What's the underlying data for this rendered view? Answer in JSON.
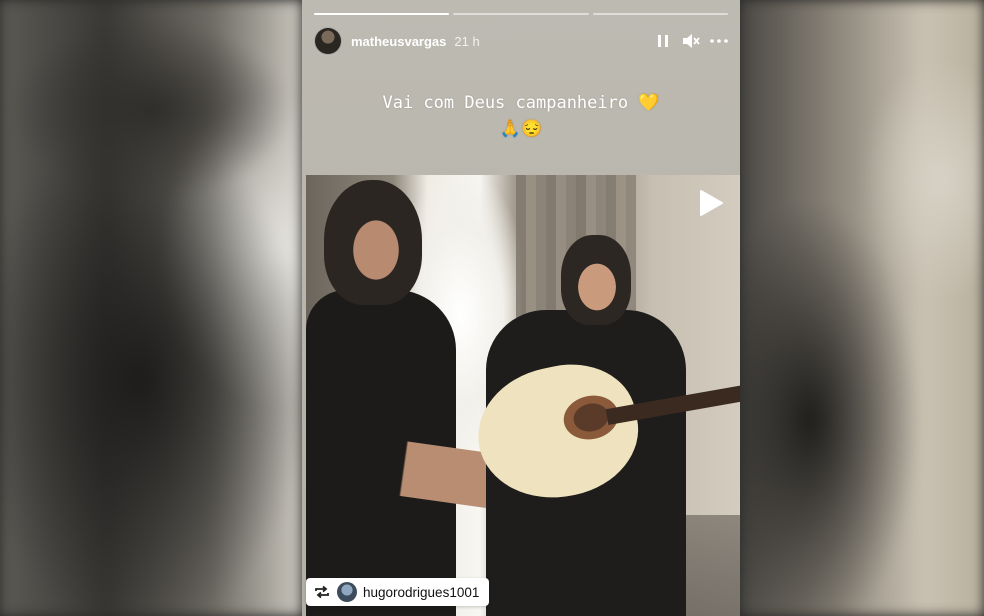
{
  "story": {
    "username": "matheusvargas",
    "time": "21 h",
    "caption_line1": "Vai com Deus campanheiro 💛",
    "caption_line2": "🙏😔",
    "progress": [
      1.0,
      0.0,
      0.0
    ],
    "repost": {
      "username": "hugorodrigues1001"
    },
    "icons": {
      "pause": "pause-icon",
      "mute": "mute-icon",
      "more": "more-icon",
      "play": "play-icon",
      "repost": "repost-icon"
    }
  }
}
